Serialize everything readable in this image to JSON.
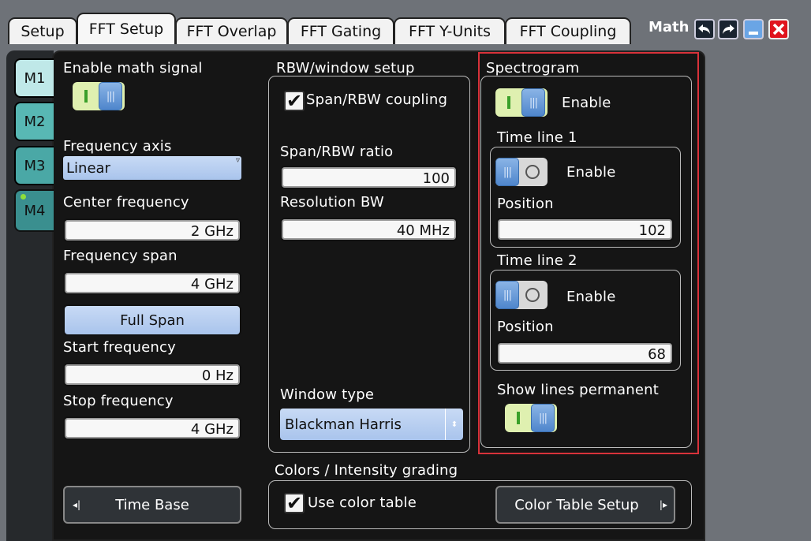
{
  "tabs": [
    {
      "label": "Setup"
    },
    {
      "label": "FFT Setup"
    },
    {
      "label": "FFT Overlap"
    },
    {
      "label": "FFT Gating"
    },
    {
      "label": "FFT Y-Units"
    },
    {
      "label": "FFT Coupling"
    }
  ],
  "window": {
    "title": "Math"
  },
  "side_tabs": [
    {
      "label": "M1"
    },
    {
      "label": "M2"
    },
    {
      "label": "M3"
    },
    {
      "label": "M4"
    }
  ],
  "left": {
    "enable_math_label": "Enable math signal",
    "freq_axis_label": "Frequency axis",
    "freq_axis_value": "Linear",
    "center_freq_label": "Center frequency",
    "center_freq_value": "2 GHz",
    "freq_span_label": "Frequency span",
    "freq_span_value": "4 GHz",
    "full_span_label": "Full Span",
    "start_freq_label": "Start frequency",
    "start_freq_value": "0 Hz",
    "stop_freq_label": "Stop frequency",
    "stop_freq_value": "4 GHz",
    "time_base_label": "Time Base"
  },
  "rbw": {
    "group_label": "RBW/window setup",
    "coupling_label": "Span/RBW coupling",
    "ratio_label": "Span/RBW ratio",
    "ratio_value": "100",
    "res_bw_label": "Resolution BW",
    "res_bw_value": "40 MHz",
    "window_type_label": "Window type",
    "window_type_value": "Blackman Harris"
  },
  "spectrogram": {
    "group_label": "Spectrogram",
    "enable_label": "Enable",
    "time_line1_label": "Time line 1",
    "time_line1_enable_label": "Enable",
    "time_line1_position_label": "Position",
    "time_line1_position_value": "102",
    "time_line2_label": "Time line 2",
    "time_line2_enable_label": "Enable",
    "time_line2_position_label": "Position",
    "time_line2_position_value": "68",
    "show_lines_label": "Show lines permanent"
  },
  "colors": {
    "group_label": "Colors / Intensity grading",
    "use_color_table_label": "Use color table",
    "color_table_setup_label": "Color Table Setup"
  }
}
